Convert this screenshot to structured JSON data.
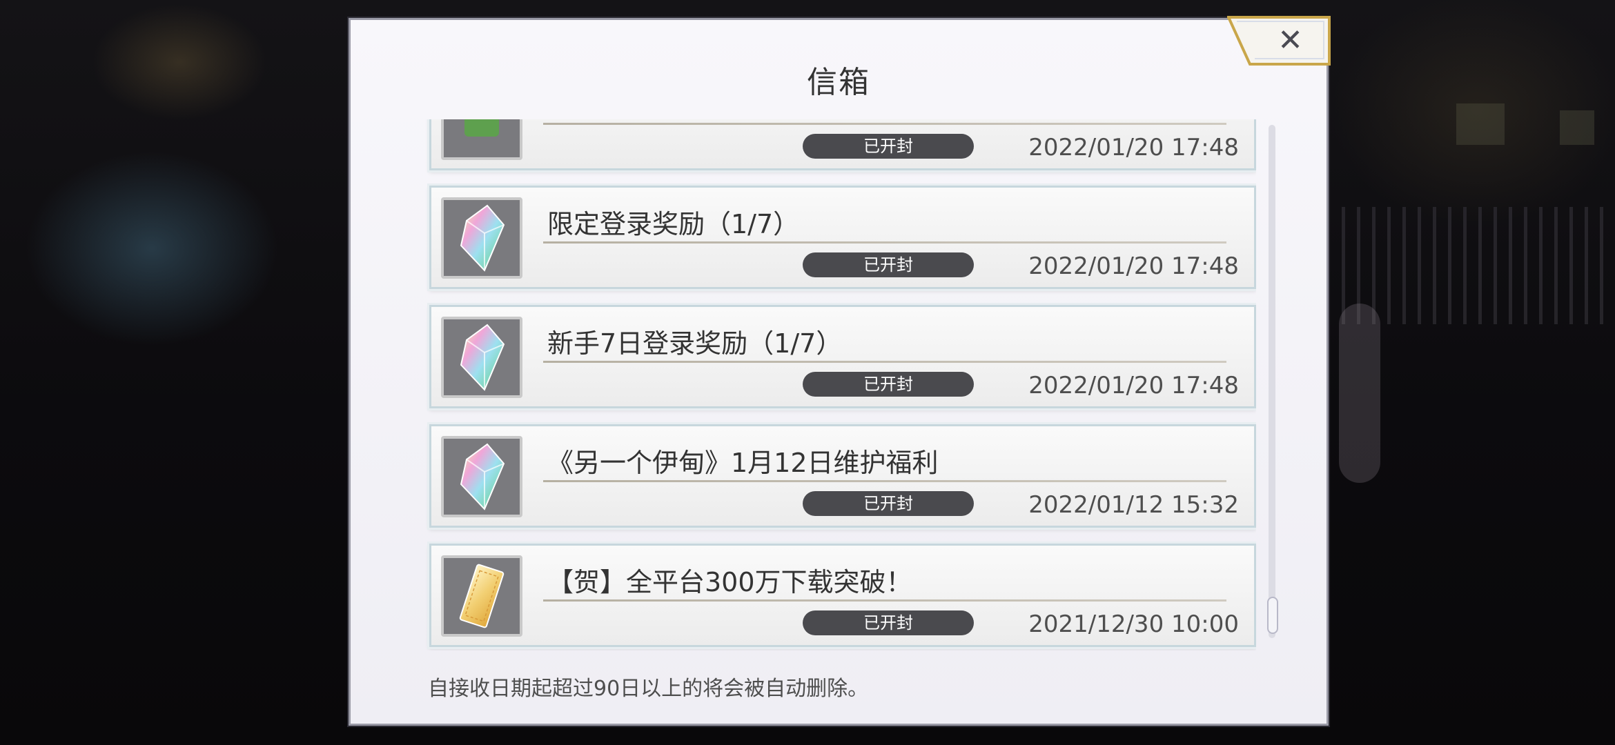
{
  "dialog": {
    "title": "信箱",
    "close_icon": "close-icon",
    "footer_note": "自接收日期起超过90日以上的将会被自动删除。"
  },
  "mails": [
    {
      "subject": "",
      "status": "已开封",
      "date": "2022/01/20 17:48",
      "icon": "green-item-icon"
    },
    {
      "subject": "限定登录奖励（1/7）",
      "status": "已开封",
      "date": "2022/01/20 17:48",
      "icon": "rainbow-crystal-icon"
    },
    {
      "subject": "新手7日登录奖励（1/7）",
      "status": "已开封",
      "date": "2022/01/20 17:48",
      "icon": "rainbow-crystal-icon"
    },
    {
      "subject": "《另一个伊甸》1月12日维护福利",
      "status": "已开封",
      "date": "2022/01/12 15:32",
      "icon": "rainbow-crystal-icon"
    },
    {
      "subject": "【贺】全平台300万下载突破！",
      "status": "已开封",
      "date": "2021/12/30 10:00",
      "icon": "gold-ticket-icon"
    }
  ],
  "scroll": {
    "position_fraction": 0.93
  },
  "colors": {
    "status_pill": "#4a4a4e",
    "card_border": "#c7d7dd",
    "dialog_bg": "#f8f7fb"
  }
}
